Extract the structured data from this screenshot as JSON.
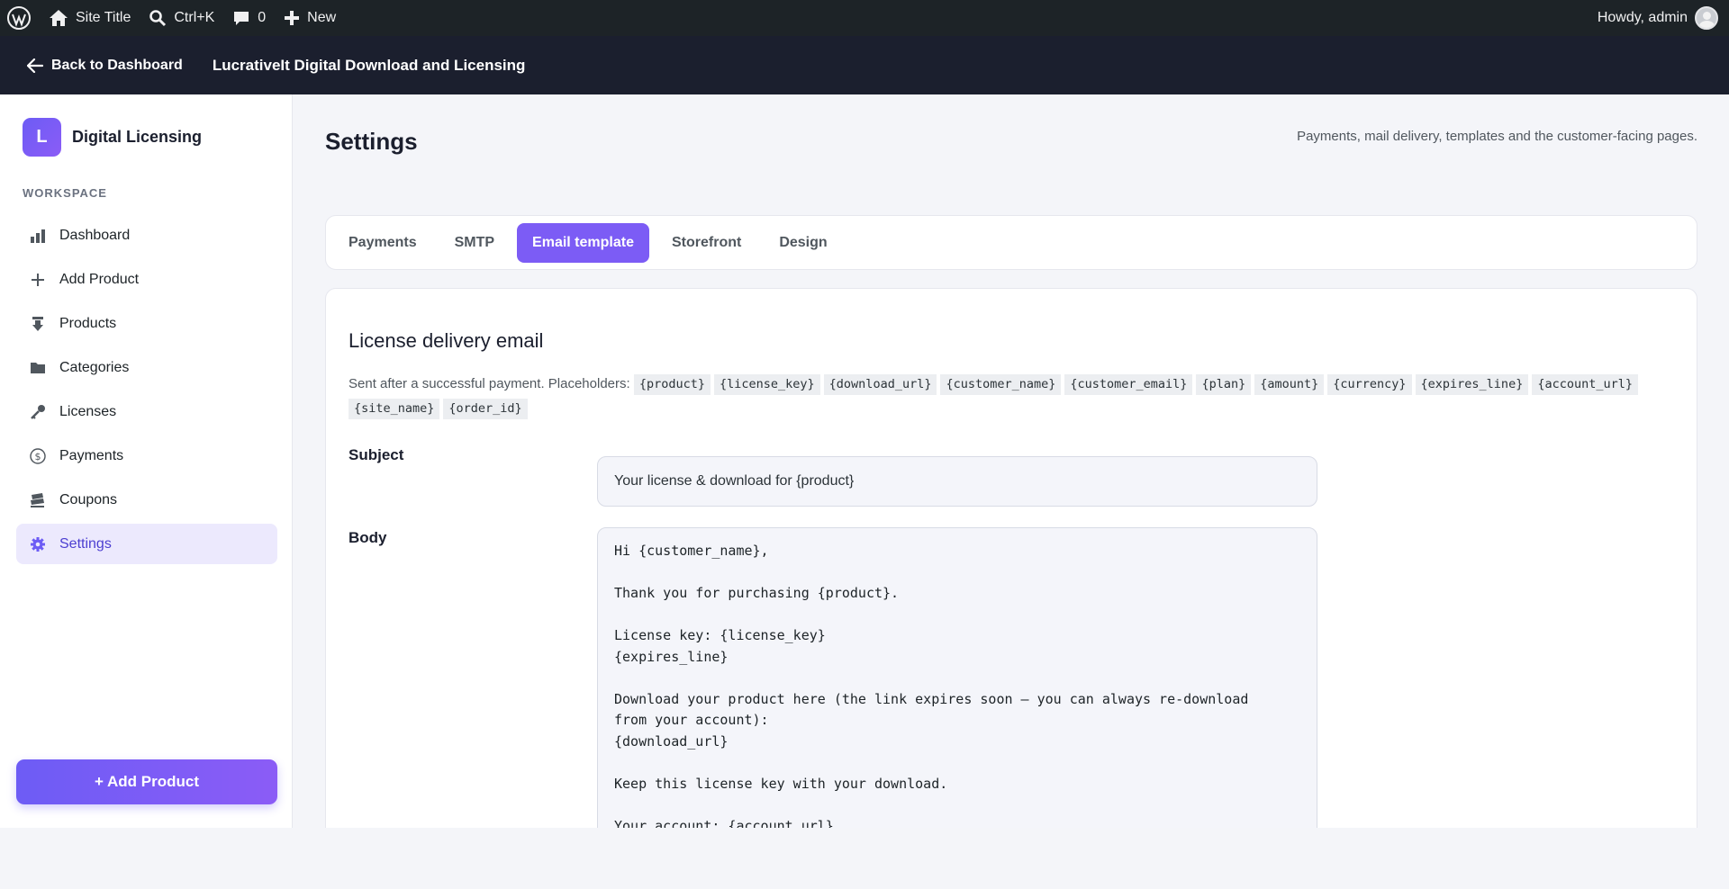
{
  "adminbar": {
    "site_title": "Site Title",
    "search_shortcut": "Ctrl+K",
    "comments_count": "0",
    "new_label": "New",
    "howdy": "Howdy, admin"
  },
  "topbar": {
    "back_label": "Back to Dashboard",
    "plugin_title": "LucrativeIt Digital Download and Licensing"
  },
  "sidebar": {
    "brand_letter": "L",
    "brand_name": "Digital Licensing",
    "section_label": "WORKSPACE",
    "items": [
      {
        "label": "Dashboard",
        "icon": "chart-bar-icon"
      },
      {
        "label": "Add Product",
        "icon": "plus-icon"
      },
      {
        "label": "Products",
        "icon": "download-icon"
      },
      {
        "label": "Categories",
        "icon": "folder-icon"
      },
      {
        "label": "Licenses",
        "icon": "key-icon"
      },
      {
        "label": "Payments",
        "icon": "dollar-circle-icon"
      },
      {
        "label": "Coupons",
        "icon": "tickets-icon"
      },
      {
        "label": "Settings",
        "icon": "gear-icon",
        "active": true
      }
    ],
    "add_button_label": "+ Add Product"
  },
  "main": {
    "title": "Settings",
    "subtitle": "Payments, mail delivery, templates and the customer-facing pages.",
    "tabs": [
      {
        "label": "Payments"
      },
      {
        "label": "SMTP"
      },
      {
        "label": "Email template",
        "active": true
      },
      {
        "label": "Storefront"
      },
      {
        "label": "Design"
      }
    ],
    "card": {
      "title": "License delivery email",
      "help_prefix": "Sent after a successful payment. Placeholders:",
      "placeholders": [
        "{product}",
        "{license_key}",
        "{download_url}",
        "{customer_name}",
        "{customer_email}",
        "{plan}",
        "{amount}",
        "{currency}",
        "{expires_line}",
        "{account_url}",
        "{site_name}",
        "{order_id}"
      ],
      "subject_label": "Subject",
      "subject_value": "Your license & download for {product}",
      "body_label": "Body",
      "body_value": "Hi {customer_name},\n\nThank you for purchasing {product}.\n\nLicense key: {license_key}\n{expires_line}\n\nDownload your product here (the link expires soon — you can always re-download\nfrom your account):\n{download_url}\n\nKeep this license key with your download.\n\nYour account: {account_url}"
    }
  },
  "colors": {
    "accent": "#7c5cf5",
    "adminbar_bg": "#1d2327",
    "topbar_bg": "#1b1f2e",
    "active_nav_bg": "#ece9fd"
  }
}
